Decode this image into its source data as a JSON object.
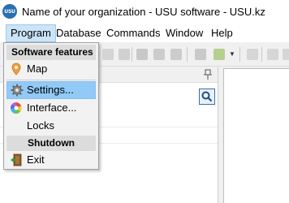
{
  "window": {
    "logo_text": "USU",
    "title": "Name of your organization - USU software - USU.kz"
  },
  "menubar": {
    "items": [
      {
        "label": "Program",
        "active": true
      },
      {
        "label": "Database"
      },
      {
        "label": "Commands"
      },
      {
        "label": "Window"
      },
      {
        "label": "Help"
      }
    ]
  },
  "dropdown": {
    "section_features": "Software features",
    "items": [
      {
        "label": "Map",
        "icon": "map-pin-icon"
      },
      {
        "label": "Settings...",
        "icon": "gear-icon",
        "highlighted": true
      },
      {
        "label": "Interface...",
        "icon": "color-wheel-icon"
      },
      {
        "label": "Locks",
        "icon": ""
      }
    ],
    "section_shutdown": "Shutdown",
    "exit_label": "Exit",
    "exit_icon": "exit-door-icon"
  },
  "colors": {
    "menu_active_bg": "#cce4f7",
    "item_highlight_bg": "#91c9f7",
    "section_header_bg": "#dcdcdc",
    "logo_blue": "#2a6fb0"
  }
}
